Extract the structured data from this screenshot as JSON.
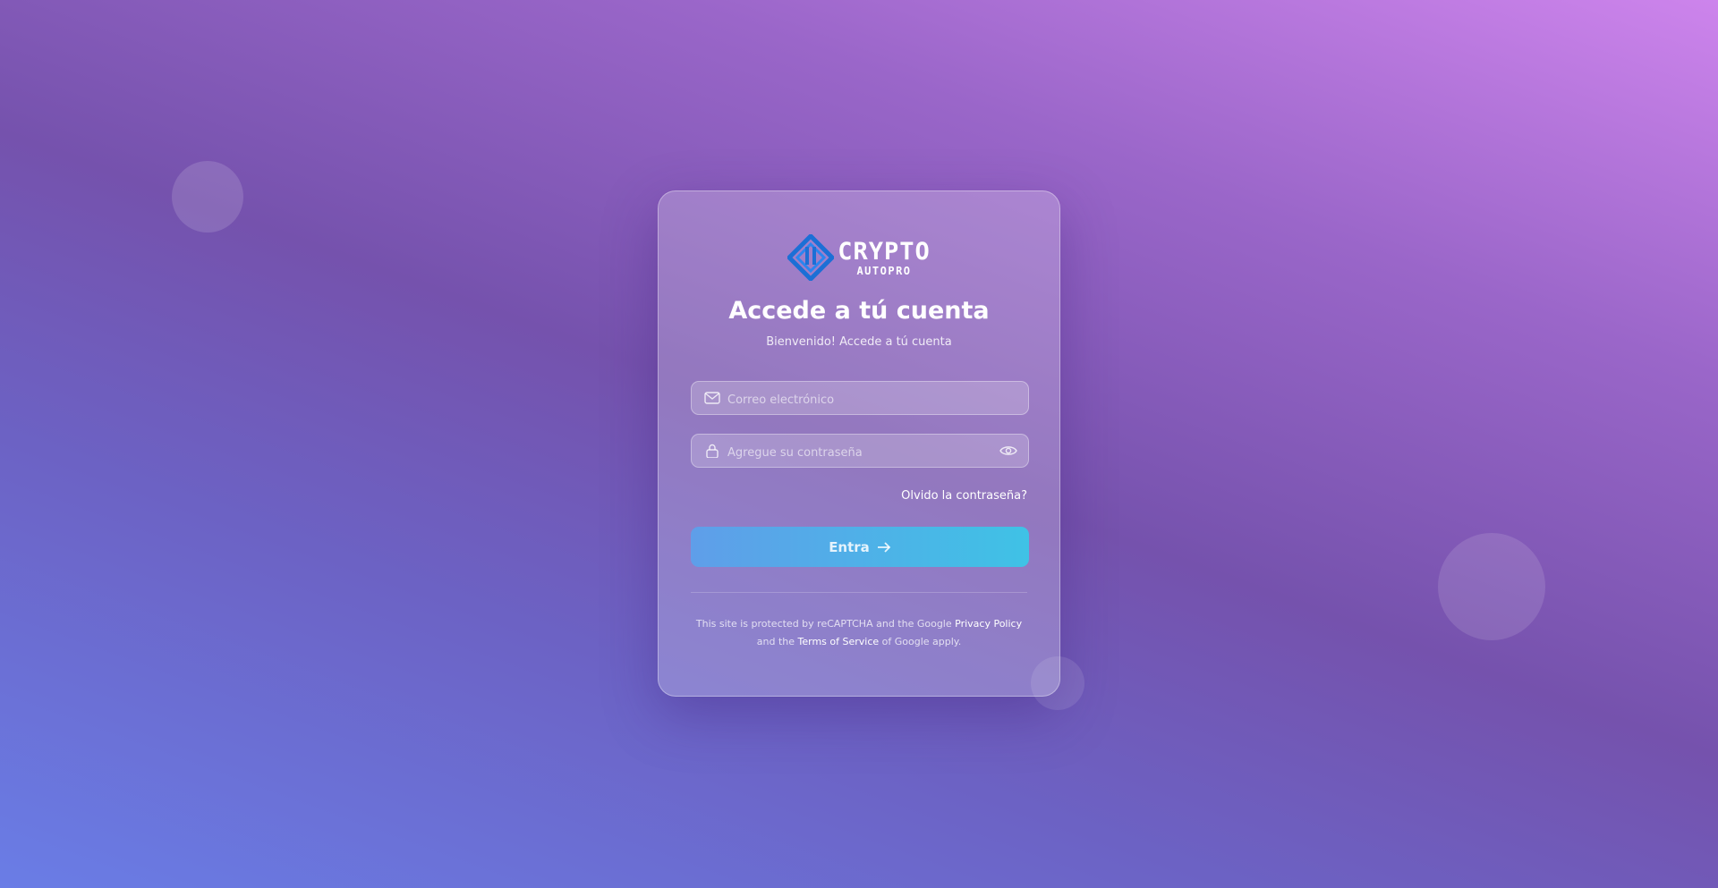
{
  "brand": {
    "name": "CRYPTO",
    "tagline": "AUTOPRO",
    "logo_icon": "diamond-logo-icon",
    "logo_color": "#1c6fd6"
  },
  "login": {
    "title": "Accede a tú cuenta",
    "subtitle": "Bienvenido! Accede a tú cuenta",
    "email": {
      "placeholder": "Correo electrónico",
      "value": "",
      "icon": "mail-icon"
    },
    "password": {
      "placeholder": "Agregue su contraseña",
      "value": "",
      "icon": "lock-icon",
      "toggle_icon": "eye-icon"
    },
    "forgot_label": "Olvido la contraseña?",
    "submit_label": "Entra",
    "submit_icon": "arrow-right-icon"
  },
  "legal": {
    "line1_prefix": "This site is protected by reCAPTCHA and the Google ",
    "privacy_label": "Privacy Policy",
    "line2_prefix": "and the ",
    "terms_label": "Terms of Service",
    "line2_suffix": " of Google apply."
  },
  "colors": {
    "button_start": "#5f9ee9",
    "button_end": "#3fc2e6"
  }
}
